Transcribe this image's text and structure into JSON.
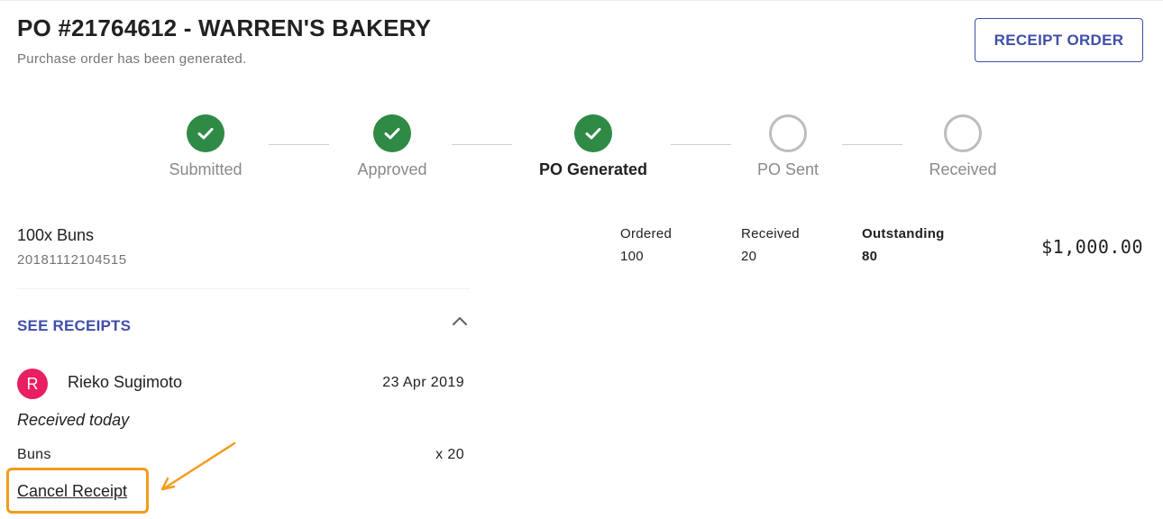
{
  "header": {
    "title": "PO #21764612 - WARREN'S BAKERY",
    "subtitle": "Purchase order has been generated.",
    "receipt_button_label": "RECEIPT ORDER"
  },
  "stepper": {
    "steps": [
      {
        "label": "Submitted",
        "status": "complete"
      },
      {
        "label": "Approved",
        "status": "complete"
      },
      {
        "label": "PO Generated",
        "status": "complete",
        "active": true
      },
      {
        "label": "PO Sent",
        "status": "pending"
      },
      {
        "label": "Received",
        "status": "pending"
      }
    ],
    "complete_color": "#2e8a45",
    "pending_color": "#bdbdbd"
  },
  "item": {
    "name": "100x Buns",
    "code": "20181112104515",
    "ordered_label": "Ordered",
    "ordered_value": "100",
    "received_label": "Received",
    "received_value": "20",
    "outstanding_label": "Outstanding",
    "outstanding_value": "80",
    "price": "$1,000.00"
  },
  "receipts": {
    "toggle_label": "SEE RECEIPTS",
    "toggle_icon": "chevron-up-icon",
    "entries": [
      {
        "avatar_initial": "R",
        "avatar_color": "#e91e63",
        "receiver": "Rieko Sugimoto",
        "date": "23 Apr 2019",
        "note": "Received today",
        "line_item": "Buns",
        "line_qty": "x 20",
        "cancel_label": "Cancel Receipt"
      }
    ]
  },
  "annotation": {
    "highlight_color": "#f39c1b"
  },
  "colors": {
    "accent": "#3f4fa8"
  }
}
